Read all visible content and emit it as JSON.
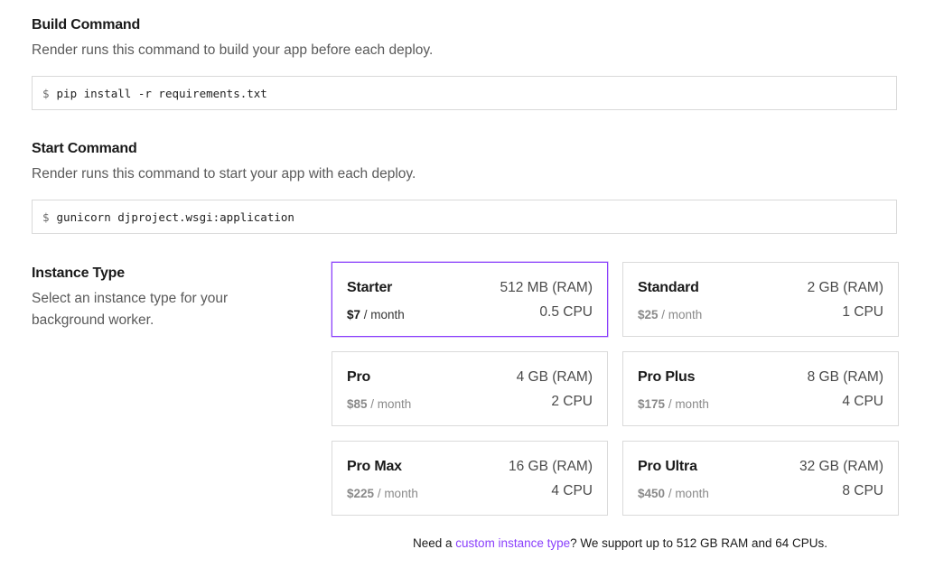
{
  "build": {
    "title": "Build Command",
    "description": "Render runs this command to build your app before each deploy.",
    "prompt": "$",
    "command": "pip install -r requirements.txt"
  },
  "start": {
    "title": "Start Command",
    "description": "Render runs this command to start your app with each deploy.",
    "prompt": "$",
    "command": "gunicorn djproject.wsgi:application"
  },
  "instance": {
    "title": "Instance Type",
    "description": "Select an instance type for your background worker.",
    "selected": "Starter",
    "per_label": "/ month",
    "cards": [
      {
        "name": "Starter",
        "ram": "512 MB (RAM)",
        "price": "$7",
        "cpu": "0.5 CPU"
      },
      {
        "name": "Standard",
        "ram": "2 GB (RAM)",
        "price": "$25",
        "cpu": "1 CPU"
      },
      {
        "name": "Pro",
        "ram": "4 GB (RAM)",
        "price": "$85",
        "cpu": "2 CPU"
      },
      {
        "name": "Pro Plus",
        "ram": "8 GB (RAM)",
        "price": "$175",
        "cpu": "4 CPU"
      },
      {
        "name": "Pro Max",
        "ram": "16 GB (RAM)",
        "price": "$225",
        "cpu": "4 CPU"
      },
      {
        "name": "Pro Ultra",
        "ram": "32 GB (RAM)",
        "price": "$450",
        "cpu": "8 CPU"
      }
    ]
  },
  "footer": {
    "prefix": "Need a ",
    "link": "custom instance type",
    "suffix": "? We support up to 512 GB RAM and 64 CPUs."
  },
  "colors": {
    "accent": "#8a3ffc",
    "border": "#dadada",
    "muted_text": "#5a5a5a"
  }
}
